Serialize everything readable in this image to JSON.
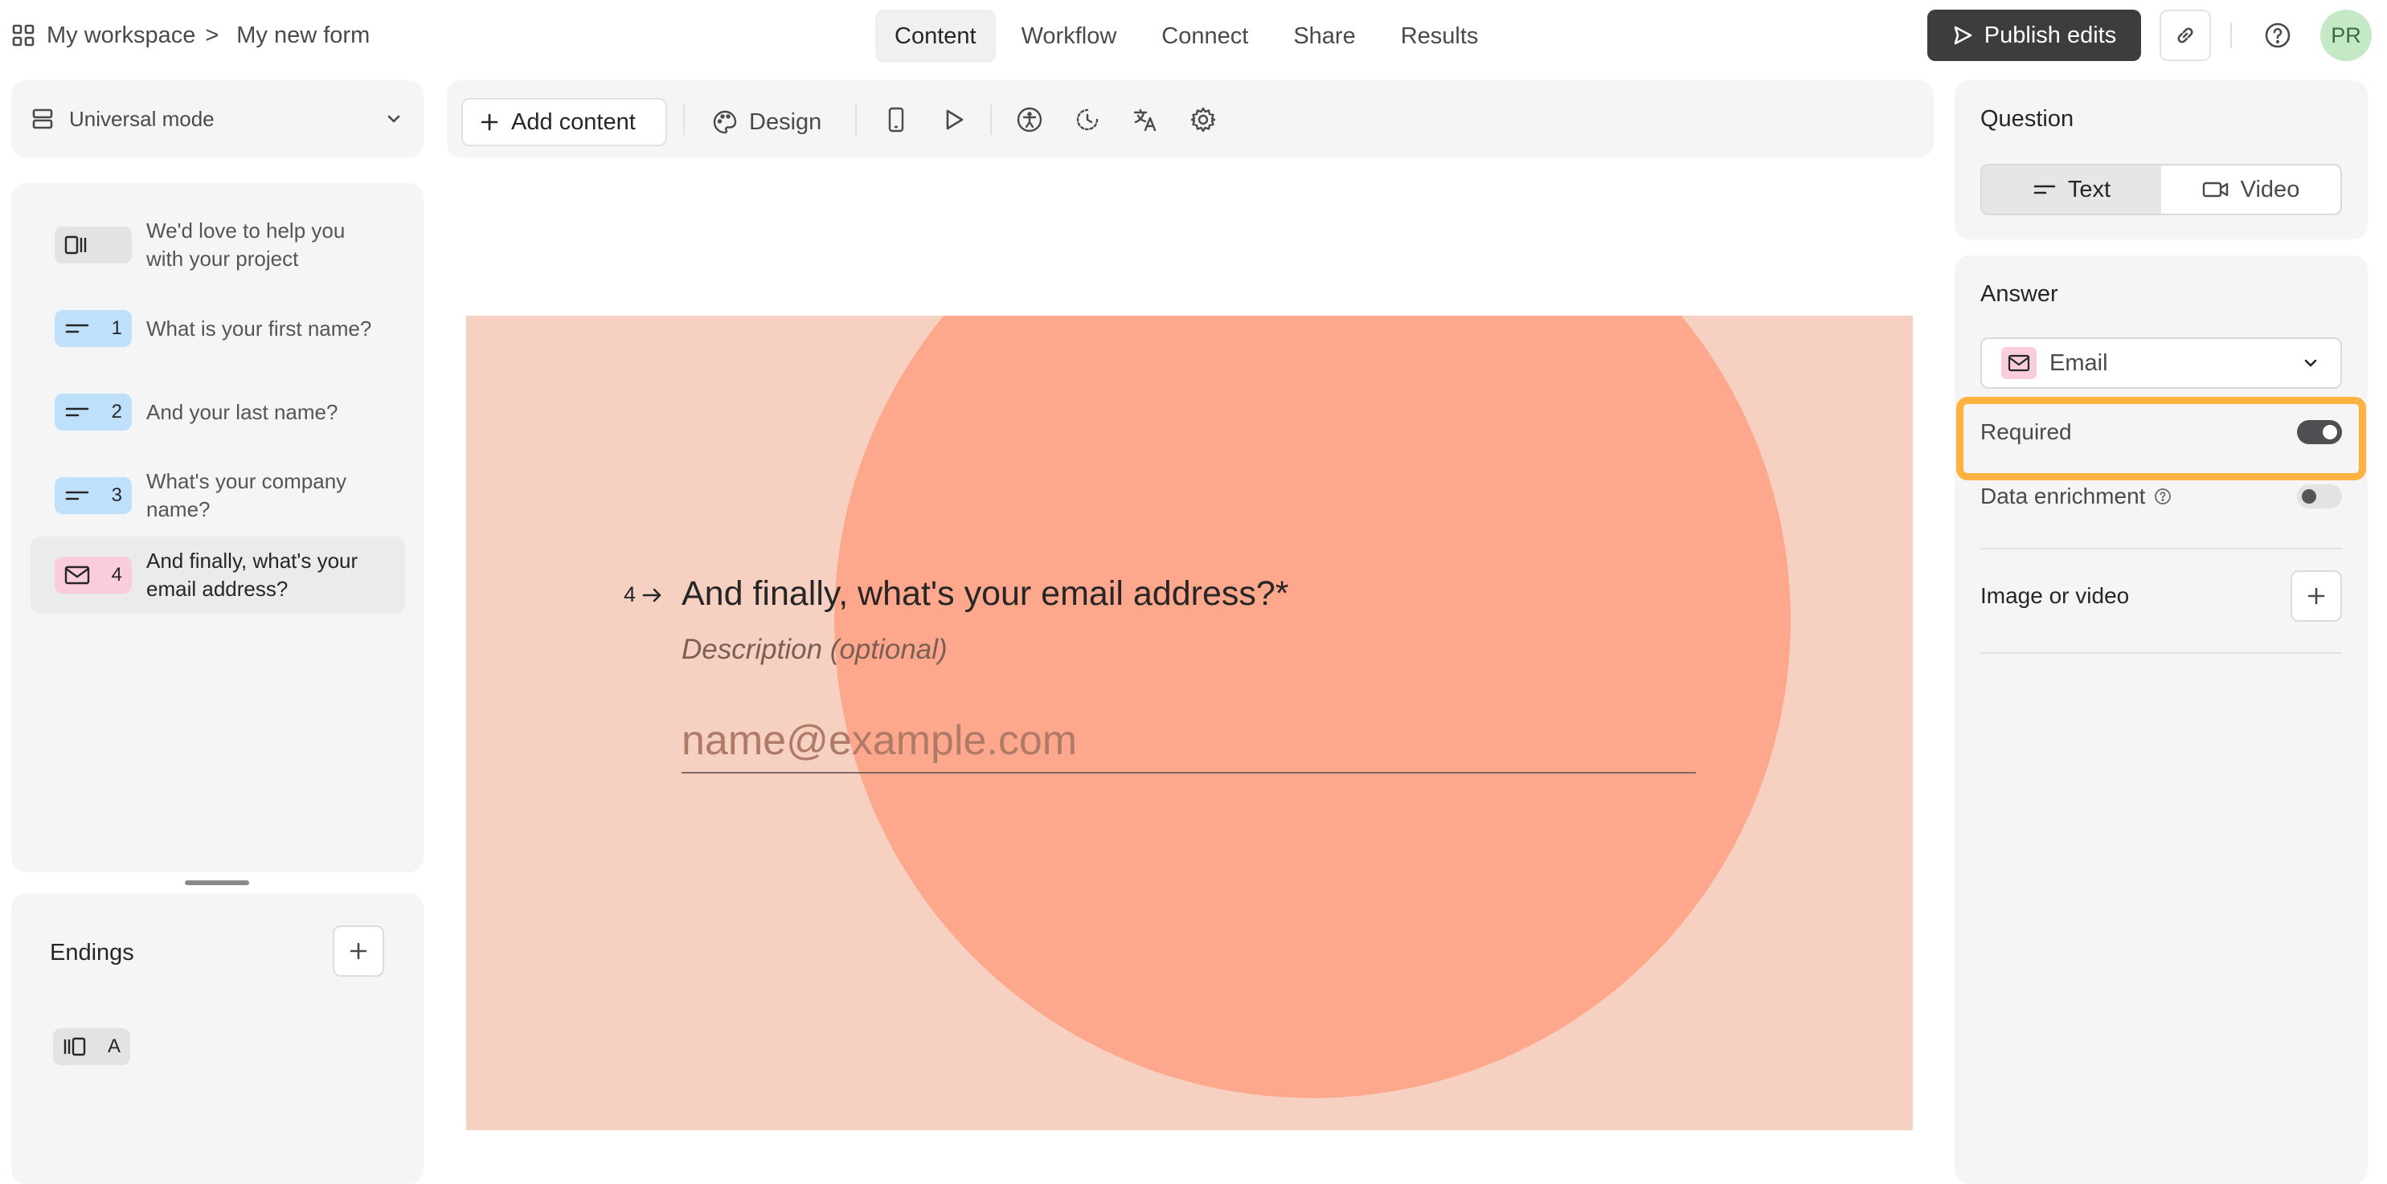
{
  "breadcrumb": {
    "workspace": "My workspace",
    "separator": ">",
    "form": "My new form"
  },
  "nav": {
    "tabs": [
      "Content",
      "Workflow",
      "Connect",
      "Share",
      "Results"
    ],
    "active": "Content"
  },
  "header": {
    "publish_label": "Publish edits",
    "avatar": "PR"
  },
  "sidebar": {
    "mode": "Universal mode",
    "questions": [
      {
        "num": "",
        "icon": "welcome-screen-icon",
        "color": "gray",
        "text": "We'd love to help you with your project"
      },
      {
        "num": "1",
        "icon": "short-text-icon",
        "color": "blue",
        "text": "What is your first name?"
      },
      {
        "num": "2",
        "icon": "short-text-icon",
        "color": "blue",
        "text": "And your last name?"
      },
      {
        "num": "3",
        "icon": "short-text-icon",
        "color": "blue",
        "text": "What's your company name?"
      },
      {
        "num": "4",
        "icon": "email-icon",
        "color": "pink",
        "text": "And finally, what's your email address?"
      }
    ],
    "endings": {
      "title": "Endings",
      "items": [
        {
          "label": "A",
          "icon": "ending-screen-icon"
        }
      ]
    }
  },
  "toolbar": {
    "add_content": "Add content",
    "design": "Design"
  },
  "canvas": {
    "number": "4",
    "question": "And finally, what's your email address?*",
    "description": "Description (optional)",
    "placeholder": "name@example.com",
    "colors": {
      "background": "#f6d0c1",
      "circle": "#fda88c"
    }
  },
  "right_panel": {
    "question_title": "Question",
    "question_types": [
      "Text",
      "Video"
    ],
    "question_type_active": "Text",
    "answer_title": "Answer",
    "answer_type": "Email",
    "required_label": "Required",
    "required_on": true,
    "enrichment_label": "Data enrichment",
    "enrichment_on": false,
    "media_label": "Image or video"
  },
  "colors": {
    "publish": "#3d3d40",
    "highlight": "#ffb23f",
    "avatar_bg": "#c5e8c6"
  }
}
